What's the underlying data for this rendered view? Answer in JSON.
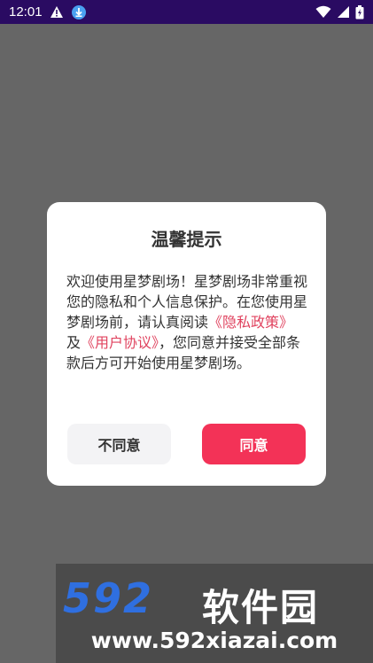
{
  "status_bar": {
    "time": "12:01",
    "left_icons": [
      "warning-icon",
      "download-icon"
    ],
    "right_icons": [
      "wifi-icon",
      "signal-icon",
      "battery-icon"
    ]
  },
  "dialog": {
    "title": "温馨提示",
    "body_segments": {
      "intro": "欢迎使用星梦剧场！星梦剧场非常重视您的隐私和个人信息保护。在您使用星梦剧场前，请认真阅读",
      "privacy_link": "《隐私政策》",
      "and": "及",
      "agreement_link": "《用户协议》",
      "outro": "，您同意并接受全部条款后方可开始使用星梦剧场。"
    },
    "disagree_label": "不同意",
    "agree_label": "同意"
  },
  "watermark": {
    "logo_number": "592",
    "logo_text": "软件园",
    "url": "www.592xiazai.com"
  },
  "colors": {
    "status_bar": "#2a0b62",
    "overlay": "#666666",
    "link": "#e0435f",
    "agree_button": "#f33257",
    "disagree_button": "#f3f3f5"
  }
}
